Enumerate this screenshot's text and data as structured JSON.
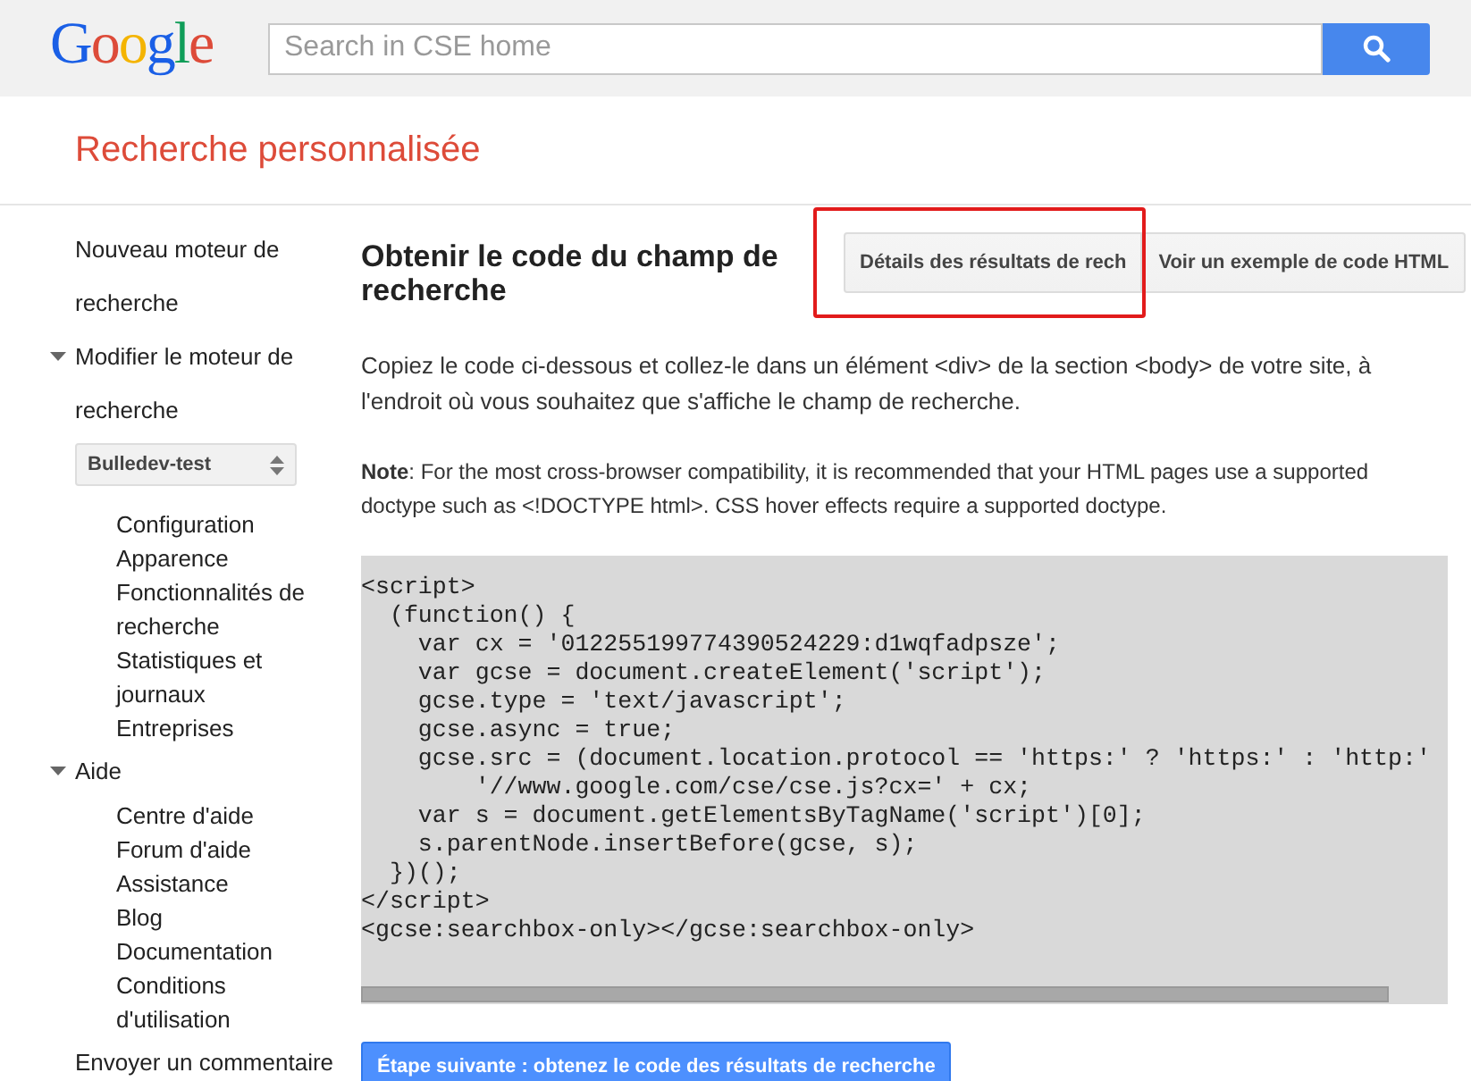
{
  "header": {
    "logo": "Google",
    "search": {
      "placeholder": "Search in CSE home"
    }
  },
  "page_title": "Recherche personnalisée",
  "sidebar": [
    {
      "kind": "link",
      "label": "Nouveau moteur de recherche"
    },
    {
      "kind": "group",
      "label": "Modifier le moteur de recherche",
      "expanded": true,
      "select": {
        "value": "Bulledev-test"
      },
      "children": [
        "Configuration",
        "Apparence",
        "Fonctionnalités de recherche",
        "Statistiques et journaux",
        "Entreprises"
      ]
    },
    {
      "kind": "group",
      "label": "Aide",
      "expanded": true,
      "children": [
        "Centre d'aide",
        "Forum d'aide",
        "Assistance",
        "Blog",
        "Documentation",
        "Conditions d'utilisation"
      ]
    },
    {
      "kind": "link",
      "label": "Envoyer un commentaire"
    }
  ],
  "main": {
    "heading": "Obtenir le code du champ de recherche",
    "tab_buttons": [
      "Détails des résultats de rech",
      "Voir un exemple de code HTML"
    ],
    "highlight_frame": true,
    "intro": "Copiez le code ci-dessous et collez-le dans un élément <div> de la section <body> de votre site, à l'endroit où vous souhaitez que s'affiche le champ de recherche.",
    "note": "**Note**: For the most cross-browser compatibility, it is recommended that your HTML pages use a supported doctype such as <!DOCTYPE html>. CSS hover effects require a supported doctype.",
    "code": [
      "<script>",
      "  (function() {",
      "    var cx = '012255199774390524229:d1wqfadpsze';",
      "    var gcse = document.createElement('script');",
      "    gcse.type = 'text/javascript';",
      "    gcse.async = true;",
      "    gcse.src = (document.location.protocol == 'https:' ? 'https:' : 'http:'",
      "        '//www.google.com/cse/cse.js?cx=' + cx;",
      "    var s = document.getElementsByTagName('script')[0];",
      "    s.parentNode.insertBefore(gcse, s);",
      "  })();",
      "</script>",
      "<gcse:searchbox-only></gcse:searchbox-only>"
    ],
    "next_button": "Étape suivante : obtenez le code des résultats de recherche"
  }
}
